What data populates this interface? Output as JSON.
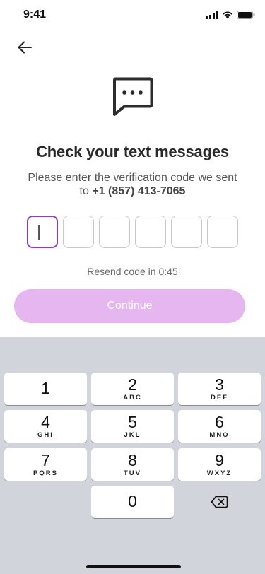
{
  "status_bar": {
    "time": "9:41",
    "icons": [
      "cellular-signal-icon",
      "wifi-icon",
      "battery-icon"
    ]
  },
  "header": {
    "back_icon": "arrow-left-icon"
  },
  "hero": {
    "icon": "chat-bubble-dots-icon"
  },
  "title": "Check your text messages",
  "subtitle": {
    "line1": "Please enter the verification code we sent",
    "to_prefix": "to ",
    "phone": "+1 (857) 413-7065"
  },
  "otp": {
    "length": 6,
    "digits": [
      "",
      "",
      "",
      "",
      "",
      ""
    ],
    "active_index": 0
  },
  "resend": "Resend code in 0:45",
  "continue_label": "Continue",
  "keyboard": {
    "keys": [
      {
        "digit": "1",
        "letters": ""
      },
      {
        "digit": "2",
        "letters": "ABC"
      },
      {
        "digit": "3",
        "letters": "DEF"
      },
      {
        "digit": "4",
        "letters": "GHI"
      },
      {
        "digit": "5",
        "letters": "JKL"
      },
      {
        "digit": "6",
        "letters": "MNO"
      },
      {
        "digit": "7",
        "letters": "PQRS"
      },
      {
        "digit": "8",
        "letters": "TUV"
      },
      {
        "digit": "9",
        "letters": "WXYZ"
      },
      {
        "digit": "0",
        "letters": ""
      }
    ],
    "delete_icon": "backspace-icon"
  },
  "colors": {
    "accent": "#8e3fb5",
    "button_disabled": "#e5b6f0",
    "keyboard_bg": "#d1d4db"
  }
}
